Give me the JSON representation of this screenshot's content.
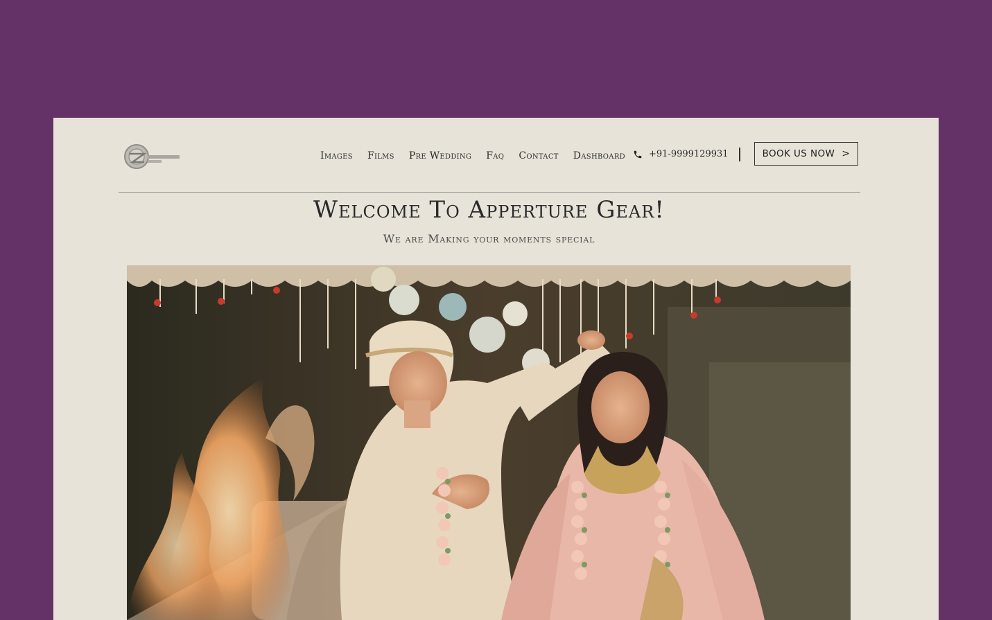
{
  "brand": {
    "logo_text": "APPERTURE GEAR"
  },
  "nav": {
    "items": [
      {
        "label": "Images"
      },
      {
        "label": "Films"
      },
      {
        "label": "Pre Wedding"
      },
      {
        "label": "Faq"
      },
      {
        "label": "Contact"
      },
      {
        "label": "Dashboard"
      }
    ],
    "phone": "+91-9999129931",
    "cta_label": "BOOK US NOW"
  },
  "hero": {
    "title": "Welcome To Apperture Gear!",
    "subtitle": "We are Making your moments special"
  },
  "colors": {
    "outer_background": "#643267",
    "page_background": "#e7e3d9",
    "text": "#2a2a2a"
  },
  "icons": [
    "phone-icon",
    "chevron-right-icon"
  ]
}
